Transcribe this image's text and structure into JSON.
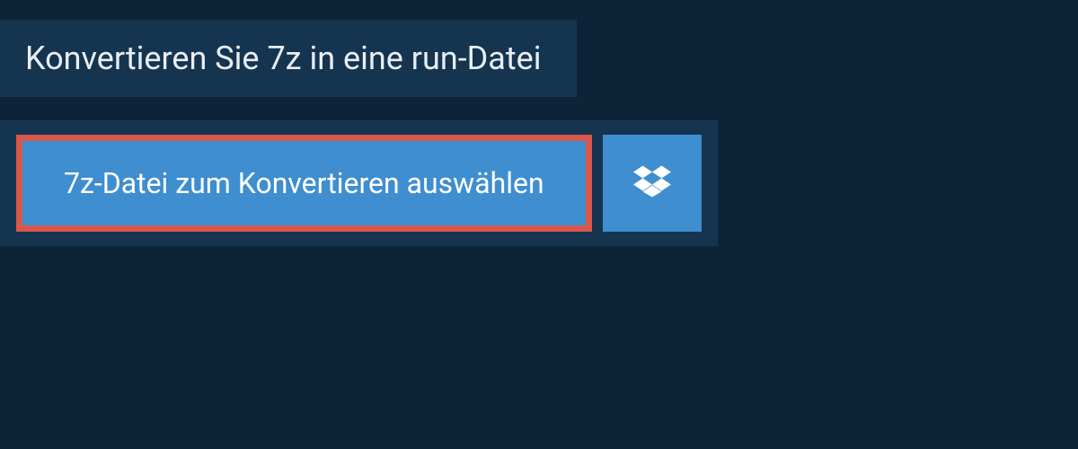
{
  "header": {
    "title": "Konvertieren Sie 7z in eine run-Datei"
  },
  "actions": {
    "select_file_label": "7z-Datei zum Konvertieren auswählen",
    "dropbox_icon": "dropbox-icon"
  },
  "colors": {
    "background": "#0d2438",
    "panel": "#153450",
    "button": "#3e8ed0",
    "highlight_border": "#d9574c",
    "text_light": "#e8eef3",
    "text_white": "#ffffff"
  }
}
